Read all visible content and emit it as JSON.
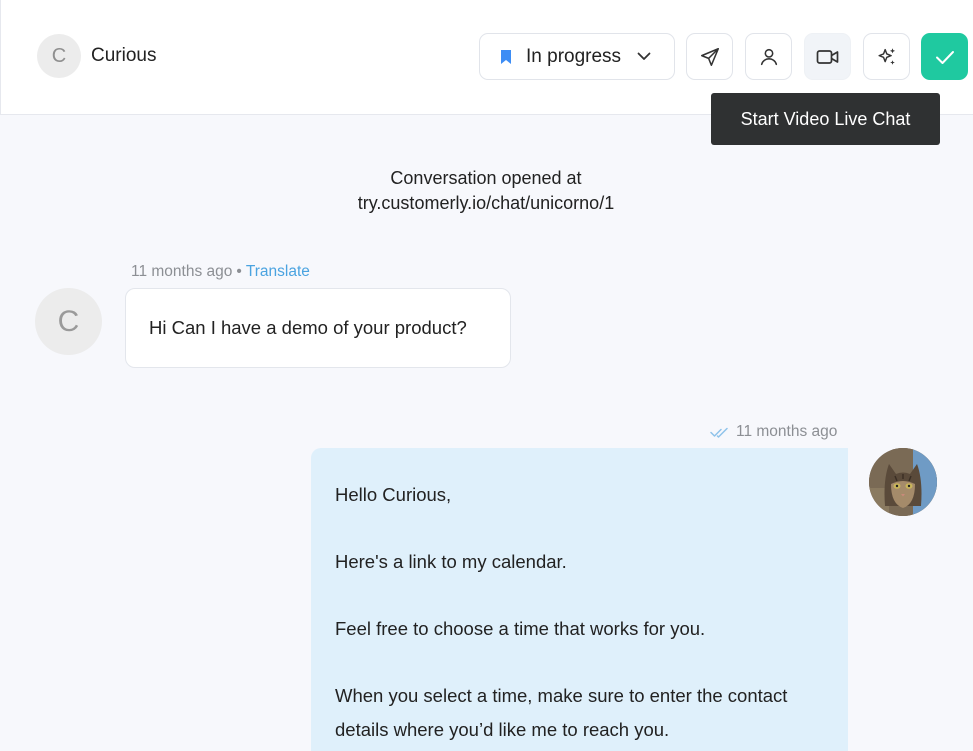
{
  "header": {
    "contact_initial": "C",
    "contact_name": "Curious",
    "status_label": "In progress",
    "tooltip": "Start Video Live Chat",
    "icons": {
      "status": "bookmark-icon",
      "chevron": "chevron-down-icon",
      "send": "send-icon",
      "profile": "user-icon",
      "video": "video-icon",
      "ai": "sparkles-icon",
      "resolve": "check-icon"
    },
    "colors": {
      "accent": "#4aa3e0",
      "resolve": "#1fc9a0",
      "bookmark": "#3d8df5"
    }
  },
  "conversation": {
    "opened_line1": "Conversation opened at",
    "opened_line2": "try.customerly.io/chat/unicorno/1",
    "messages": [
      {
        "sender_initial": "C",
        "time": "11 months ago",
        "translate": "Translate",
        "text": "Hi Can I have a demo of your product?"
      },
      {
        "time": "11 months ago",
        "lines": [
          "Hello Curious,",
          "Here's a link to my calendar.",
          "Feel free to choose a time that works for you.",
          "When you select a time, make sure to enter the contact details where you’d like me to reach you."
        ]
      }
    ]
  }
}
